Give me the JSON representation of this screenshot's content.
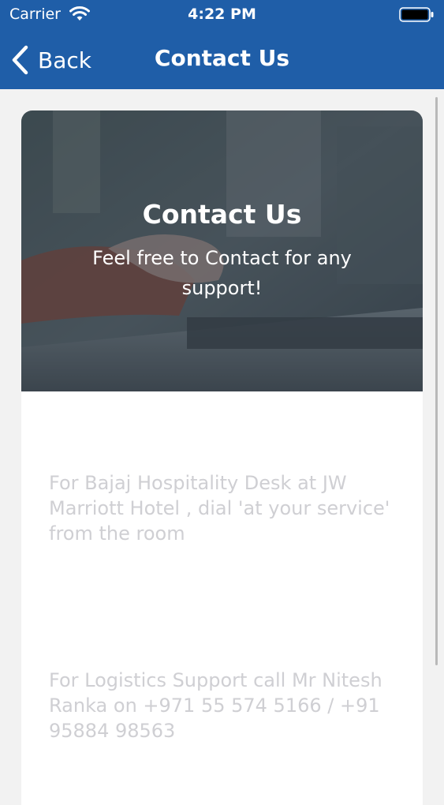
{
  "status_bar": {
    "carrier": "Carrier",
    "time": "4:22 PM",
    "wifi_icon": "wifi-icon",
    "battery_icon": "battery-icon"
  },
  "nav": {
    "back_label": "Back",
    "back_icon": "chevron-left-icon",
    "title": "Contact Us"
  },
  "hero": {
    "title": "Contact Us",
    "subtitle": "Feel free to Contact for any support!"
  },
  "contacts": [
    {
      "text": "For Bajaj Hospitality Desk at JW Marriott Hotel , dial 'at your service' from the room"
    },
    {
      "text": "For Logistics Support call Mr Nitesh Ranka on +971 55 574 5166 / +91 95884 98563"
    }
  ],
  "colors": {
    "header_bg": "#1f5ea8",
    "page_bg": "#f2f2f2",
    "card_bg": "#ffffff",
    "info_text": "#cfcfd3"
  }
}
